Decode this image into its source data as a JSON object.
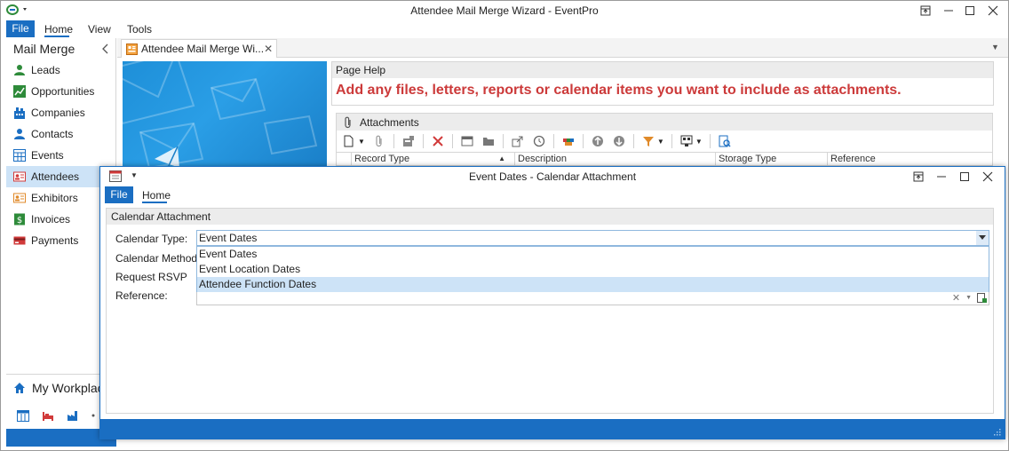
{
  "main_window": {
    "title": "Attendee Mail Merge Wizard - EventPro",
    "menu": {
      "file": "File",
      "home": "Home",
      "view": "View",
      "tools": "Tools"
    }
  },
  "sidebar": {
    "title": "Mail Merge",
    "items": [
      {
        "label": "Leads",
        "icon": "person-icon",
        "color": "#2e8b3a"
      },
      {
        "label": "Opportunities",
        "icon": "trend-chart-icon",
        "color": "#2e8b3a"
      },
      {
        "label": "Companies",
        "icon": "building-icon",
        "color": "#1a6ec2"
      },
      {
        "label": "Contacts",
        "icon": "person-icon",
        "color": "#1a6ec2"
      },
      {
        "label": "Events",
        "icon": "calendar-grid-icon",
        "color": "#1a6ec2"
      },
      {
        "label": "Attendees",
        "icon": "id-card-icon",
        "color": "#d13a3a"
      },
      {
        "label": "Exhibitors",
        "icon": "id-card-icon",
        "color": "#e08a2a"
      },
      {
        "label": "Invoices",
        "icon": "dollar-icon",
        "color": "#2e8b3a"
      },
      {
        "label": "Payments",
        "icon": "credit-card-icon",
        "color": "#d13a3a"
      }
    ],
    "workplace": "My Workplace"
  },
  "doc_tab": {
    "label": "Attendee Mail Merge Wi..."
  },
  "page_help": {
    "header": "Page Help",
    "text": "Add any files, letters, reports or calendar items you want to include as attachments."
  },
  "attachments": {
    "header": "Attachments",
    "columns": [
      "Record Type",
      "Description",
      "Storage Type",
      "Reference"
    ]
  },
  "dialog": {
    "title": "Event Dates - Calendar Attachment",
    "menu": {
      "file": "File",
      "home": "Home"
    },
    "panel_header": "Calendar Attachment",
    "labels": {
      "calendar_type": "Calendar Type:",
      "calendar_method": "Calendar Method:",
      "request_rsvp": "Request RSVP",
      "reference": "Reference:"
    },
    "calendar_type_value": "Event Dates",
    "options": [
      "Event Dates",
      "Event Location Dates",
      "Attendee Function Dates"
    ],
    "selected_option": "Attendee Function Dates"
  },
  "colors": {
    "accent": "#1a6ec2",
    "help_text": "#cc3a3a",
    "selection": "#cde3f7"
  }
}
